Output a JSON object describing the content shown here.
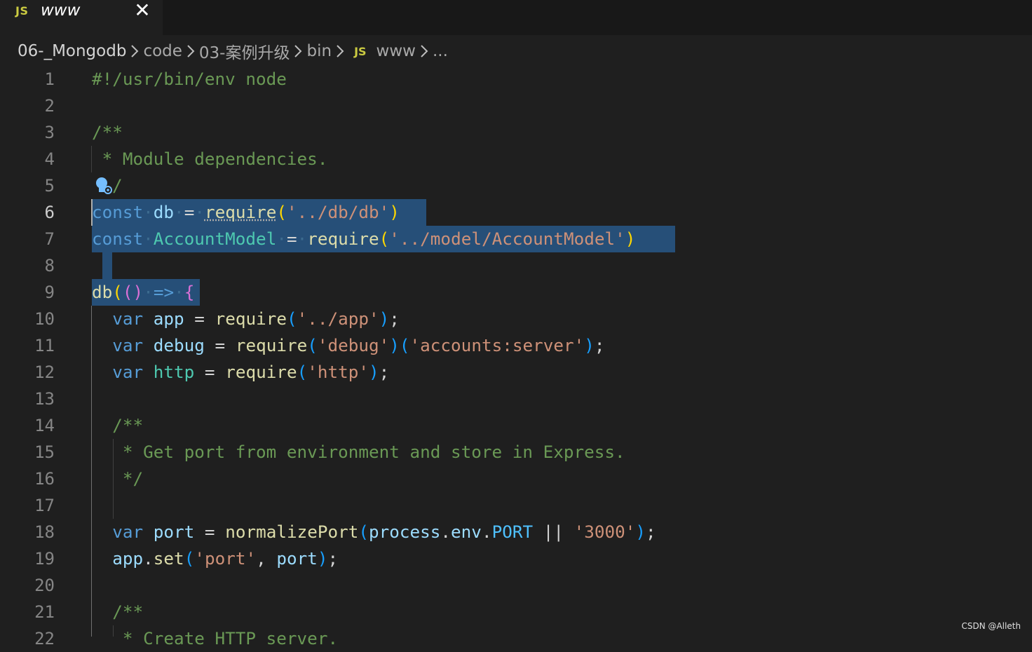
{
  "tab": {
    "icon": "JS",
    "title": "www",
    "close_glyph": "✕"
  },
  "breadcrumb": {
    "items": [
      "06-_Mongodb",
      "code",
      "03-案例升级",
      "bin"
    ],
    "file_icon": "JS",
    "file": "www",
    "more": "..."
  },
  "editor": {
    "line_numbers": [
      "1",
      "2",
      "3",
      "4",
      "5",
      "6",
      "7",
      "8",
      "9",
      "10",
      "11",
      "12",
      "13",
      "14",
      "15",
      "16",
      "17",
      "18",
      "19",
      "20",
      "21",
      "22"
    ],
    "active_line": "6",
    "lines": {
      "l1": "#!/usr/bin/env node",
      "l3": "/**",
      "l4": " * Module dependencies.",
      "l5": "/",
      "l6": [
        "const",
        "·",
        "db",
        "·",
        "=",
        "·",
        "require",
        "(",
        "'../db/db'",
        ")"
      ],
      "l7": [
        "const",
        "·",
        "AccountModel",
        "·",
        "=",
        "·",
        "require",
        "(",
        "'../model/AccountModel'",
        ")"
      ],
      "l9": [
        "db",
        "(",
        "(",
        ")",
        "·",
        "=>",
        "·",
        "{"
      ],
      "l10": [
        "  var ",
        "app",
        " = ",
        "require",
        "(",
        "'../app'",
        ")",
        ";"
      ],
      "l11": [
        "  var ",
        "debug",
        " = ",
        "require",
        "(",
        "'debug'",
        ")",
        "(",
        "'accounts:server'",
        ")",
        ";"
      ],
      "l12": [
        "  var ",
        "http",
        " = ",
        "require",
        "(",
        "'http'",
        ")",
        ";"
      ],
      "l14": "  /**",
      "l15": "   * Get port from environment and store in Express.",
      "l16": "   */",
      "l18": [
        "  var ",
        "port",
        " = ",
        "normalizePort",
        "(",
        "process",
        ".",
        "env",
        ".",
        "PORT",
        " || ",
        "'3000'",
        ")",
        ";"
      ],
      "l19": [
        "  ",
        "app",
        ".",
        "set",
        "(",
        "'port'",
        ", ",
        "port",
        ")",
        ";"
      ],
      "l21": "  /**",
      "l22": "   * Create HTTP server."
    }
  },
  "watermark": "CSDN @Alleth",
  "colors": {
    "background": "#1f1f1f",
    "selection": "#264f78",
    "comment": "#6a9955",
    "keyword": "#569cd6",
    "string": "#ce9178"
  }
}
